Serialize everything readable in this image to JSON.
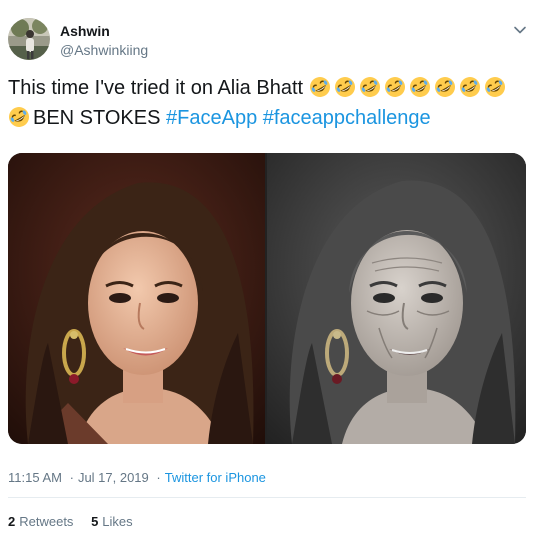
{
  "author": {
    "display_name": "Ashwin",
    "handle": "@Ashwinkiing"
  },
  "tweet": {
    "text_part1": "This time I've tried it on Alia Bhatt",
    "emoji_line1_count": 8,
    "emoji_name": "rolling-on-the-floor-laughing-emoji",
    "text_part2": "BEN STOKES",
    "hashtags": [
      "#FaceApp",
      "#faceappchallenge"
    ]
  },
  "media": {
    "photos": [
      {
        "name": "original-photo"
      },
      {
        "name": "aged-photo"
      }
    ]
  },
  "meta": {
    "time": "11:15 AM",
    "date": "Jul 17, 2019",
    "separator": "·",
    "source": "Twitter for iPhone"
  },
  "stats": {
    "retweets_count": "2",
    "retweets_label": "Retweets",
    "likes_count": "5",
    "likes_label": "Likes"
  },
  "colors": {
    "link": "#1b95e0",
    "secondary_text": "#657786",
    "primary_text": "#14171a",
    "divider": "#e6ecf0"
  },
  "icons": [
    "chevron-down-icon",
    "avatar"
  ]
}
